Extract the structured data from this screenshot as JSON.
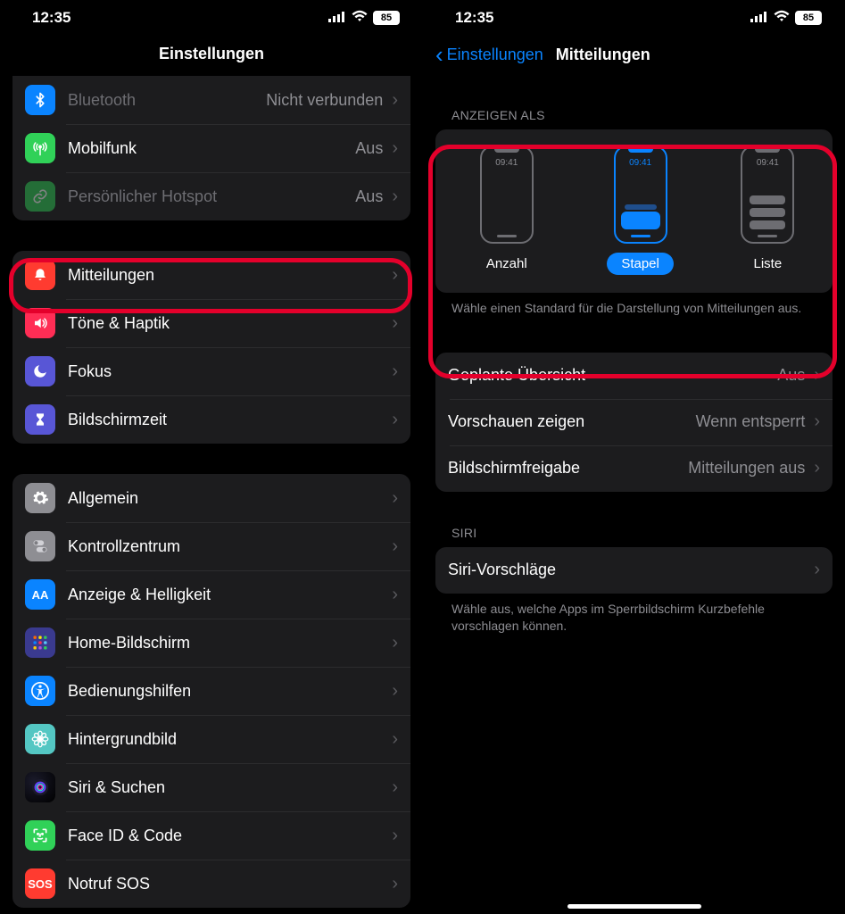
{
  "status": {
    "time": "12:35",
    "battery": "85"
  },
  "left": {
    "title": "Einstellungen",
    "group1": [
      {
        "icon_bg": "#0a84ff",
        "glyph": "svg:bluetooth",
        "glyph_color": "#fff",
        "label": "Bluetooth",
        "value": "Nicht verbunden",
        "disabled": true
      },
      {
        "icon_bg": "#30d158",
        "glyph": "svg:antenna",
        "glyph_color": "#fff",
        "label": "Mobilfunk",
        "value": "Aus"
      },
      {
        "icon_bg": "#30d158",
        "glyph": "svg:link",
        "glyph_color": "#fff",
        "label": "Persönlicher Hotspot",
        "value": "Aus",
        "disabled": true,
        "dim_icon": true
      }
    ],
    "group2": [
      {
        "icon_bg": "#ff3b30",
        "glyph": "svg:bell",
        "label": "Mitteilungen",
        "highlighted": true
      },
      {
        "icon_bg": "#ff2d55",
        "glyph": "svg:speaker",
        "label": "Töne & Haptik"
      },
      {
        "icon_bg": "#5856d6",
        "glyph": "svg:moon",
        "label": "Fokus"
      },
      {
        "icon_bg": "#5856d6",
        "glyph": "svg:hourglass",
        "label": "Bildschirmzeit"
      }
    ],
    "group3": [
      {
        "icon_bg": "#8e8e93",
        "glyph": "svg:gear",
        "label": "Allgemein"
      },
      {
        "icon_bg": "#8e8e93",
        "glyph": "svg:switches",
        "label": "Kontrollzentrum"
      },
      {
        "icon_bg": "#0a84ff",
        "glyph": "text:AA",
        "label": "Anzeige & Helligkeit"
      },
      {
        "icon_bg": "#3a3a8f",
        "glyph": "svg:grid",
        "label": "Home-Bildschirm"
      },
      {
        "icon_bg": "#0a84ff",
        "glyph": "svg:accessibility",
        "label": "Bedienungshilfen"
      },
      {
        "icon_bg": "#54c7c3",
        "glyph": "svg:flower",
        "label": "Hintergrundbild"
      },
      {
        "icon_bg": "siri",
        "glyph": "svg:siri",
        "label": "Siri & Suchen"
      },
      {
        "icon_bg": "#30d158",
        "glyph": "svg:faceid",
        "label": "Face ID & Code"
      },
      {
        "icon_bg": "#ff3b30",
        "glyph": "text:SOS",
        "label": "Notruf SOS"
      }
    ]
  },
  "right": {
    "back": "Einstellungen",
    "title": "Mitteilungen",
    "display_as_header": "ANZEIGEN ALS",
    "display_as_footer": "Wähle einen Standard für die Darstellung von Mitteilungen aus.",
    "options": [
      {
        "label": "Anzahl",
        "time": "09:41"
      },
      {
        "label": "Stapel",
        "time": "09:41",
        "selected": true
      },
      {
        "label": "Liste",
        "time": "09:41"
      }
    ],
    "settings": [
      {
        "label": "Geplante Übersicht",
        "value": "Aus"
      },
      {
        "label": "Vorschauen zeigen",
        "value": "Wenn entsperrt"
      },
      {
        "label": "Bildschirmfreigabe",
        "value": "Mitteilungen aus"
      }
    ],
    "siri_header": "SIRI",
    "siri_row": {
      "label": "Siri-Vorschläge"
    },
    "siri_footer": "Wähle aus, welche Apps im Sperrbildschirm Kurzbefehle vorschlagen können."
  }
}
